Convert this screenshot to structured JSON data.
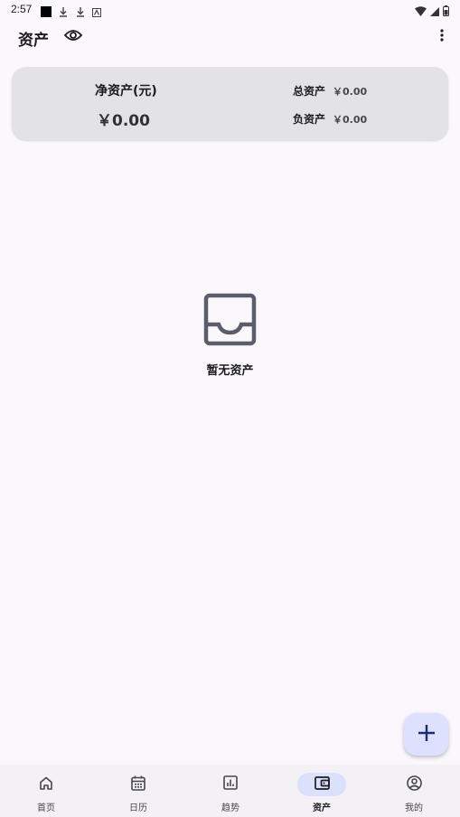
{
  "status_bar": {
    "time": "2:57",
    "icons": [
      "square-notification-icon",
      "download-icon",
      "download-icon",
      "app-notification-icon",
      "wifi-icon",
      "signal-icon",
      "battery-icon"
    ]
  },
  "appbar": {
    "title": "资产",
    "visibility_icon": "eye-icon",
    "menu_icon": "more-vert-icon"
  },
  "summary": {
    "net_label": "净资产(元)",
    "net_value": "￥0.00",
    "total_label": "总资产",
    "total_value": "￥0.00",
    "debt_label": "负资产",
    "debt_value": "￥0.00"
  },
  "empty_state": {
    "icon": "inbox-icon",
    "text": "暂无资产"
  },
  "fab": {
    "icon": "plus-icon"
  },
  "bottom_nav": {
    "items": [
      {
        "label": "首页",
        "icon": "home-icon",
        "active": false
      },
      {
        "label": "日历",
        "icon": "calendar-icon",
        "active": false
      },
      {
        "label": "趋势",
        "icon": "chart-icon",
        "active": false
      },
      {
        "label": "资产",
        "icon": "wallet-icon",
        "active": true
      },
      {
        "label": "我的",
        "icon": "account-icon",
        "active": false
      }
    ]
  },
  "colors": {
    "background": "#fbf8fd",
    "card": "#e3e2e7",
    "fab": "#dde1ff",
    "nav_active_pill": "#dbe1fa",
    "nav_background": "#f3f0f6"
  }
}
